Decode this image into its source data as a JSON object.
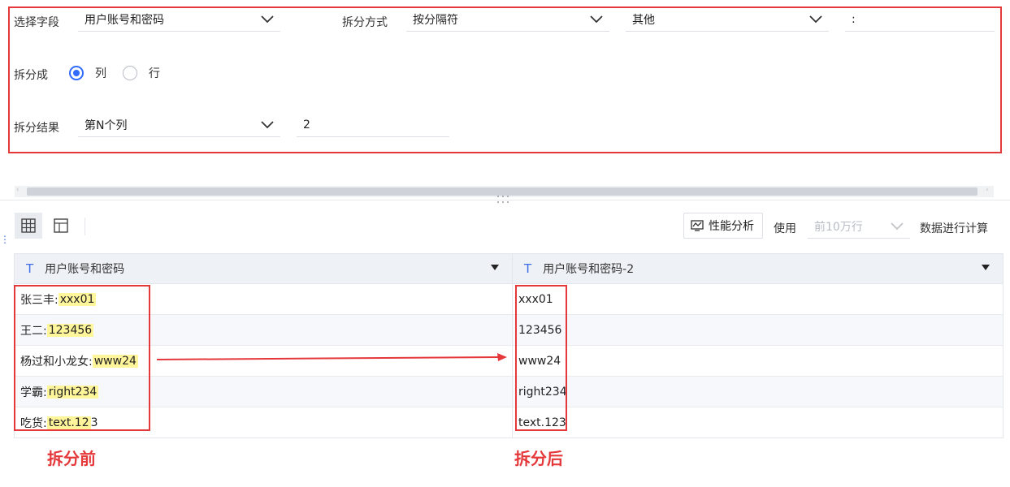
{
  "config": {
    "field_label": "选择字段",
    "field_value": "用户账号和密码",
    "method_label": "拆分方式",
    "method_value": "按分隔符",
    "separator_value": "其他",
    "custom_separator": ":",
    "split_into_label": "拆分成",
    "option_column": "列",
    "option_row": "行",
    "result_label": "拆分结果",
    "result_value": "第N个列",
    "result_n": "2"
  },
  "toolbar": {
    "perf_label": "性能分析",
    "use_label": "使用",
    "rows_placeholder": "前10万行",
    "compute_label": "数据进行计算"
  },
  "table": {
    "columns": [
      "用户账号和密码",
      "用户账号和密码-2"
    ],
    "rows": [
      {
        "prefix": "张三丰:",
        "value": "xxx01",
        "tail": "",
        "split": "xxx01"
      },
      {
        "prefix": "王二:",
        "value": "123456",
        "tail": "",
        "split": "123456"
      },
      {
        "prefix": "杨过和小龙女:",
        "value": "www24",
        "tail": "",
        "split": "www24"
      },
      {
        "prefix": "学霸:",
        "value": "right234",
        "tail": "",
        "split": "right234"
      },
      {
        "prefix": "吃货:",
        "value": "text.12",
        "tail": "3",
        "split": "text.123"
      }
    ]
  },
  "annotations": {
    "before": "拆分前",
    "after": "拆分后",
    "accent_color": "#e5383b"
  },
  "colors": {
    "primary": "#2f6bff",
    "highlight": "#fff59a"
  }
}
